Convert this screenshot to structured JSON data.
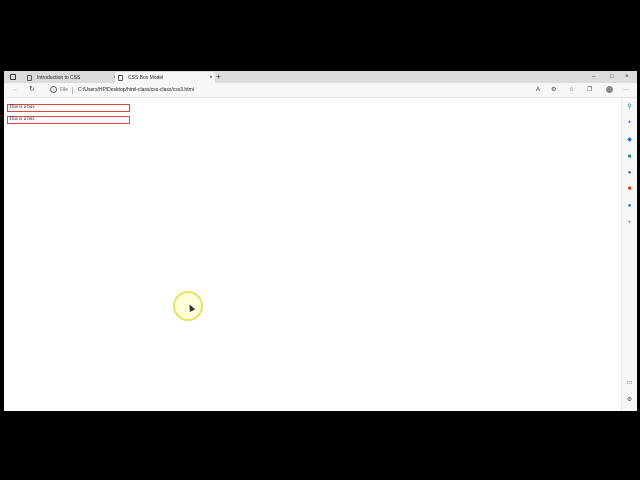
{
  "tabs": [
    {
      "title": "Introduction to CSS",
      "close": "×"
    },
    {
      "title": "CSS Box Model",
      "close": "×"
    }
  ],
  "tabbar": {
    "new_tab": "+",
    "minimize": "–",
    "maximize": "□",
    "close": "×"
  },
  "addressbar": {
    "back": "←",
    "reload": "↻",
    "info": "i",
    "file_label": "File",
    "url": "C:/Users/HP/Desktop/html-class/css-class/css3.html",
    "more": "···"
  },
  "page": {
    "boxes": [
      "This is a box",
      "This is a box"
    ],
    "box_border_color": "#dd4444"
  },
  "sidebar_icons": [
    "search-icon",
    "shopping-icon",
    "tools-icon",
    "games-icon",
    "microsoft-365-icon",
    "office-icon",
    "outlook-icon",
    "add-icon",
    "split-screen-icon",
    "settings-icon"
  ]
}
